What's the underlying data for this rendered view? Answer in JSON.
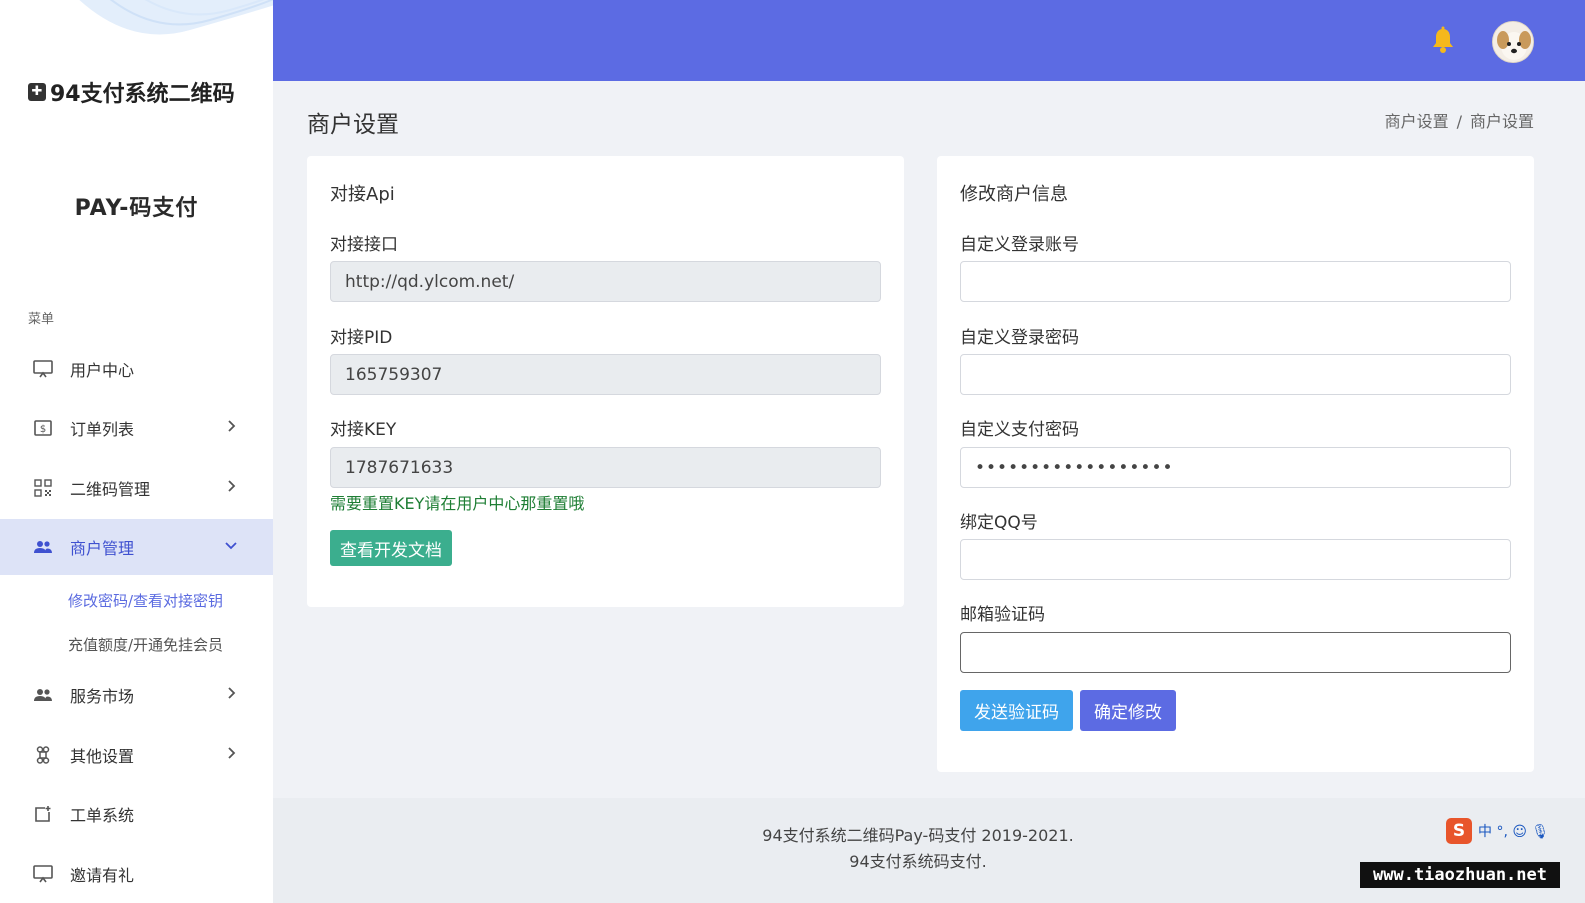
{
  "sidebar": {
    "logo_text": "94支付系统二维码",
    "brand_sub": "PAY-码支付",
    "menu_title": "菜单",
    "items": [
      {
        "label": "用户中心"
      },
      {
        "label": "订单列表"
      },
      {
        "label": "二维码管理"
      },
      {
        "label": "商户管理"
      },
      {
        "label": "服务市场"
      },
      {
        "label": "其他设置"
      },
      {
        "label": "工单系统"
      },
      {
        "label": "邀请有礼"
      }
    ],
    "sub_items": [
      {
        "label": "修改密码/查看对接密钥"
      },
      {
        "label": "充值额度/开通免挂会员"
      }
    ]
  },
  "header": {
    "icons": [
      "bell-icon",
      "avatar"
    ],
    "accent": "#5c6be3"
  },
  "page": {
    "title": "商户设置",
    "breadcrumb": [
      "商户设置",
      "商户设置"
    ],
    "breadcrumb_sep": "/"
  },
  "api_card": {
    "title": "对接Api",
    "fields": [
      {
        "label": "对接接口",
        "value": "http://qd.ylcom.net/"
      },
      {
        "label": "对接PID",
        "value": "165759307"
      },
      {
        "label": "对接KEY",
        "value": "1787671633"
      }
    ],
    "hint": "需要重置KEY请在用户中心那重置哦",
    "doc_button": "查看开发文档"
  },
  "merchant_card": {
    "title": "修改商户信息",
    "fields": [
      {
        "label": "自定义登录账号",
        "value": ""
      },
      {
        "label": "自定义登录密码",
        "value": ""
      },
      {
        "label": "自定义支付密码",
        "value": "••••••••••••••••••"
      },
      {
        "label": "绑定QQ号",
        "value": ""
      },
      {
        "label": "邮箱验证码",
        "value": ""
      }
    ],
    "send_code_button": "发送验证码",
    "confirm_button": "确定修改"
  },
  "footer": {
    "line1": "94支付系统二维码Pay-码支付 2019-2021.",
    "line2": "94支付系统码支付."
  },
  "ime": {
    "logo": "S",
    "text": "中 °, ☺ 🎙"
  },
  "watermark": "www.tiaozhuan.net"
}
